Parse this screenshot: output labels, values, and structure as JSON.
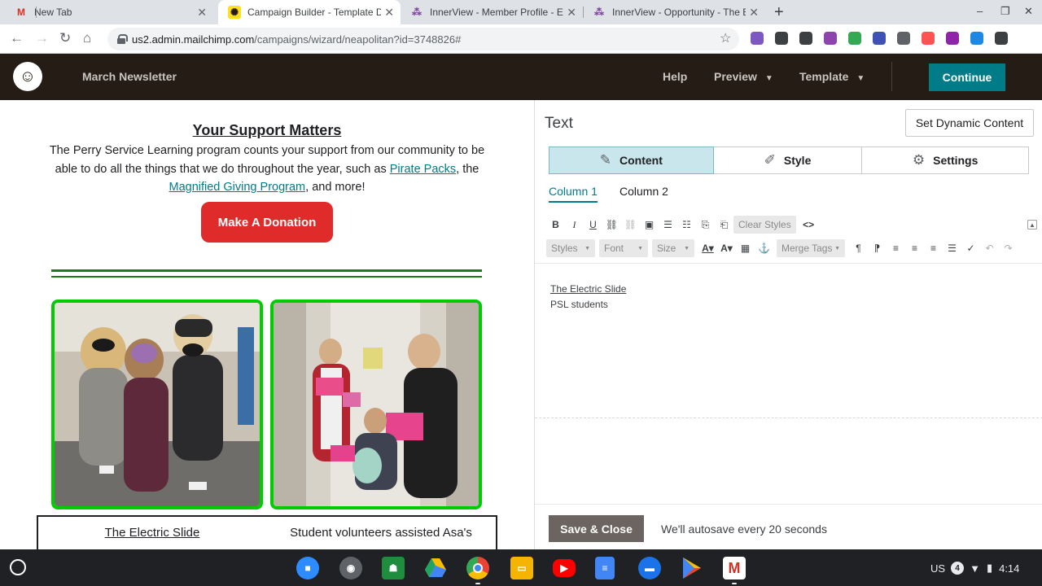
{
  "browser": {
    "tabs": [
      {
        "title": "New Tab",
        "favicon": "gmail-icon",
        "active": false
      },
      {
        "title": "Campaign Builder - Template De",
        "favicon": "mailchimp-icon",
        "active": true
      },
      {
        "title": "InnerView - Member Profile - Em",
        "favicon": "innerview-icon",
        "active": false
      },
      {
        "title": "InnerView - Opportunity - The Ele",
        "favicon": "innerview-icon",
        "active": false
      }
    ],
    "url_host": "us2.admin.mailchimp.com",
    "url_path": "/campaigns/wizard/neapolitan?id=3748826#",
    "extension_colors": [
      "#7e57c2",
      "#3c4043",
      "#3c4043",
      "#8e44ad",
      "#34a853",
      "#3f51b5",
      "#5f6368",
      "#ff5252",
      "#8e24aa",
      "#1e88e5",
      "#3c4043"
    ]
  },
  "header": {
    "campaign_name": "March Newsletter",
    "help": "Help",
    "preview": "Preview",
    "template": "Template",
    "continue": "Continue"
  },
  "preview": {
    "title": "Your Support Matters",
    "body_prefix": "The Perry Service Learning program counts your support from our community to be able to do all the things that we do throughout the year, such as ",
    "link1": "Pirate Packs",
    "body_mid": ", the ",
    "link2": "Magnified Giving Program",
    "body_suffix": ", and more!",
    "donate_button": "Make A Donation",
    "caption_left": "The Electric Slide",
    "caption_right": "Student volunteers assisted Asa's"
  },
  "editor": {
    "title": "Text",
    "dynamic_button": "Set Dynamic Content",
    "tabs": [
      "Content",
      "Style",
      "Settings"
    ],
    "active_tab": "Content",
    "columns": [
      "Column 1",
      "Column 2"
    ],
    "clear_styles": "Clear Styles",
    "dropdowns": [
      "Styles",
      "Font",
      "Size"
    ],
    "merge_tags": "Merge Tags",
    "content_line1": "The Electric Slide",
    "content_line2": "PSL students",
    "save_close": "Save & Close",
    "autosave": "We'll autosave every 20 seconds"
  },
  "shelf": {
    "apps": [
      "zoom",
      "camera",
      "classroom",
      "drive",
      "chrome",
      "slides",
      "youtube",
      "docs",
      "files",
      "play-store",
      "gmail"
    ],
    "locale": "US",
    "notification_count": "4",
    "time": "4:14"
  }
}
